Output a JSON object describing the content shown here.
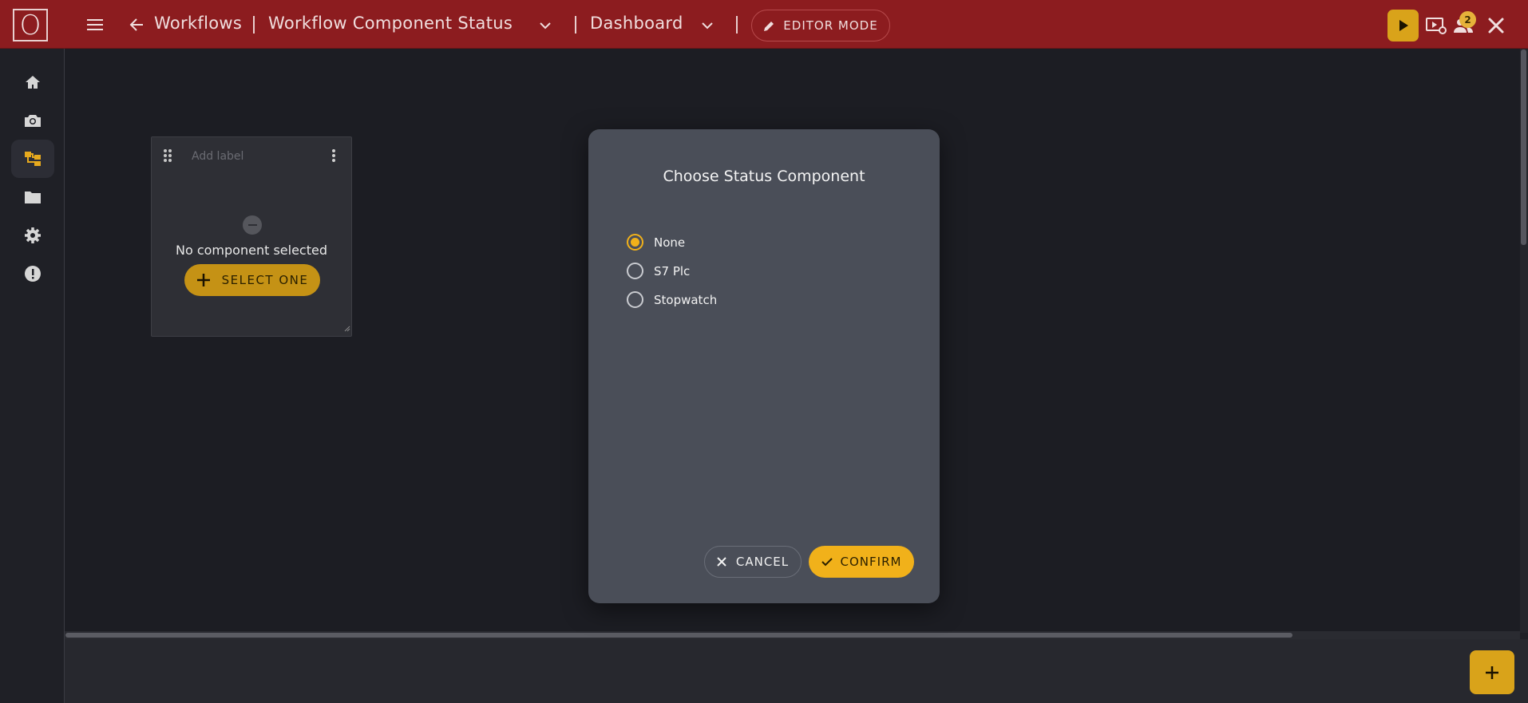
{
  "header": {
    "logo_letter": "O",
    "breadcrumb_root": "Workflows",
    "workflow_name": "Workflow Component Status",
    "view_name": "Dashboard",
    "editor_mode_label": "EDITOR MODE",
    "notification_count": "2",
    "accent_color": "#8c1c1f"
  },
  "sidebar": {
    "items": [
      {
        "icon": "home-icon"
      },
      {
        "icon": "camera-icon"
      },
      {
        "icon": "workflow-icon",
        "active": true
      },
      {
        "icon": "folder-icon"
      },
      {
        "icon": "settings-icon"
      },
      {
        "icon": "alert-icon"
      }
    ]
  },
  "widget": {
    "label_placeholder": "Add label",
    "empty_text": "No component selected",
    "select_button": "SELECT ONE"
  },
  "modal": {
    "title": "Choose Status Component",
    "options": [
      {
        "label": "None",
        "selected": true
      },
      {
        "label": "S7 Plc",
        "selected": false
      },
      {
        "label": "Stopwatch",
        "selected": false
      }
    ],
    "cancel_label": "CANCEL",
    "confirm_label": "CONFIRM",
    "primary_color": "#f1b11a"
  }
}
